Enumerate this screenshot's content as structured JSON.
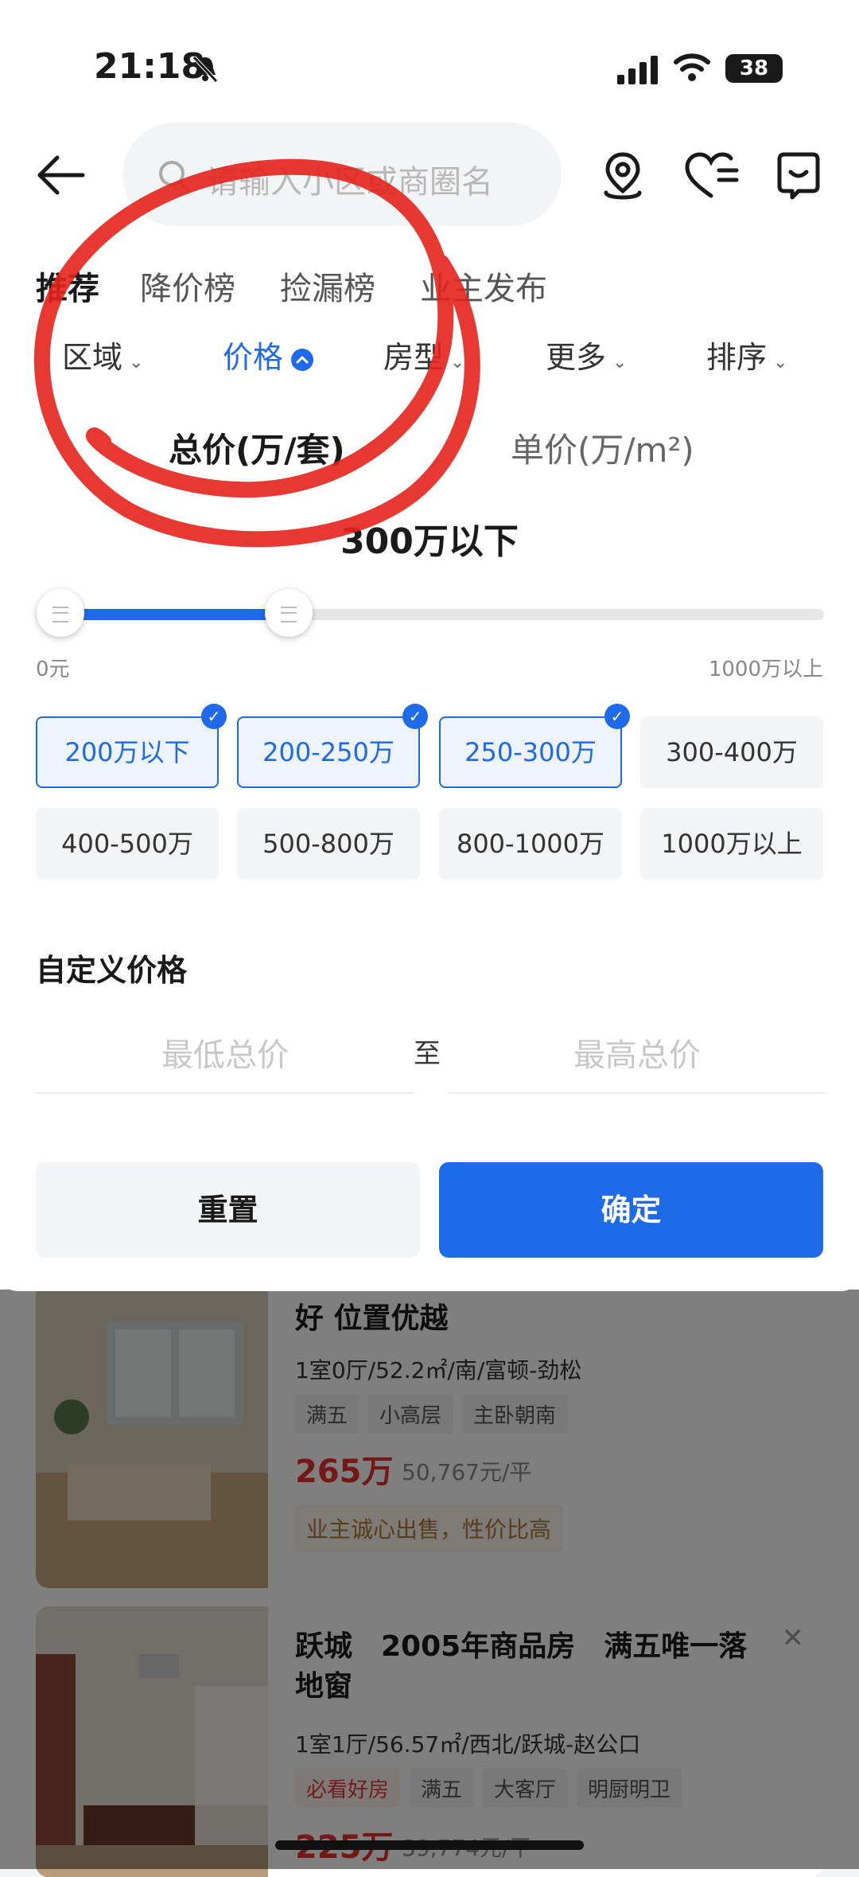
{
  "status_bar": {
    "time": "21:18",
    "battery": "38"
  },
  "search": {
    "placeholder": "请输入小区或商圈名"
  },
  "topics": [
    "推荐",
    "降价榜",
    "捡漏榜",
    "业主发布"
  ],
  "filters": [
    "区域",
    "价格",
    "房型",
    "更多",
    "排序"
  ],
  "price_tabs": [
    "总价(万/套)",
    "单价(万/m²)"
  ],
  "range": {
    "label": "300万以下",
    "min_label": "0元",
    "max_label": "1000万以上",
    "selected_fraction": 0.3
  },
  "chips": [
    {
      "label": "200万以下",
      "selected": true
    },
    {
      "label": "200-250万",
      "selected": true
    },
    {
      "label": "250-300万",
      "selected": true
    },
    {
      "label": "300-400万",
      "selected": false
    },
    {
      "label": "400-500万",
      "selected": false
    },
    {
      "label": "500-800万",
      "selected": false
    },
    {
      "label": "800-1000万",
      "selected": false
    },
    {
      "label": "1000万以上",
      "selected": false
    }
  ],
  "custom": {
    "title": "自定义价格",
    "min_placeholder": "最低总价",
    "to": "至",
    "max_placeholder": "最高总价"
  },
  "buttons": {
    "reset": "重置",
    "confirm": "确定"
  },
  "listings": [
    {
      "title": "好 位置优越",
      "meta": "1室0厅/52.2㎡/南/富顿-劲松",
      "tags": [
        "满五",
        "小高层",
        "主卧朝南"
      ],
      "price": "265万",
      "unit_price": "50,767元/平",
      "note": "业主诚心出售，性价比高"
    },
    {
      "title": "跃城　2005年商品房　满五唯一落地窗",
      "meta": "1室1厅/56.57㎡/西北/跃城-赵公口",
      "tags": [
        "必看好房",
        "满五",
        "大客厅",
        "明厨明卫"
      ],
      "price": "225万",
      "unit_price": "39,774元/平"
    }
  ]
}
